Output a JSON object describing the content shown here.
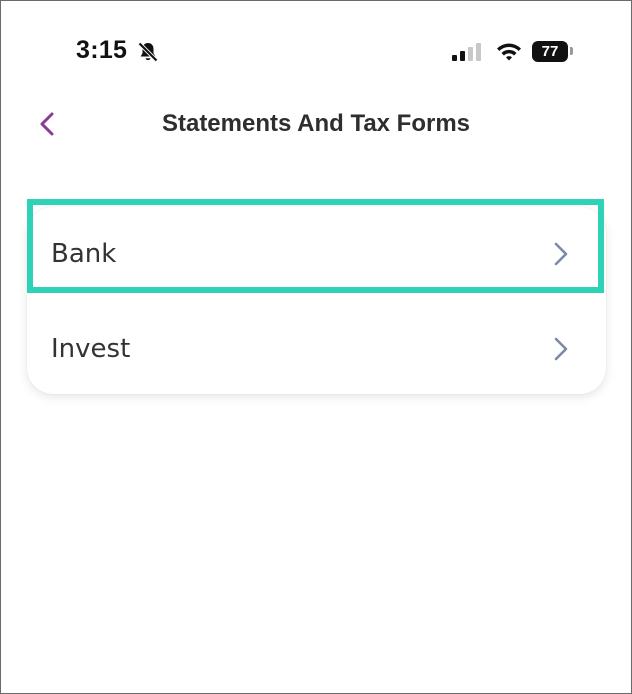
{
  "status_bar": {
    "time": "3:15",
    "battery": "77",
    "icons": [
      "bell-slash-icon",
      "signal-icon",
      "wifi-icon",
      "battery-icon"
    ]
  },
  "nav": {
    "title": "Statements And Tax Forms",
    "back_icon": "chevron-left-icon",
    "accent_color": "#8a3a97"
  },
  "menu": {
    "items": [
      {
        "label": "Bank",
        "icon": "chevron-right-icon"
      },
      {
        "label": "Invest",
        "icon": "chevron-right-icon"
      }
    ],
    "chevron_color": "#7c8aa8",
    "highlight_color": "#2ed3b7"
  }
}
